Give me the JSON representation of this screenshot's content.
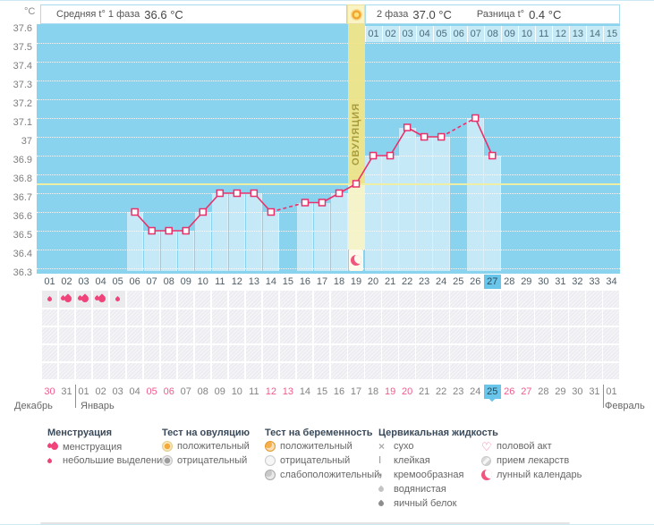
{
  "header": {
    "unit_label": "°C",
    "phase1_label": "Средняя t° 1 фаза",
    "phase1_value": "36.6 °C",
    "phase2_label": "2 фаза",
    "phase2_value": "37.0 °C",
    "diff_label": "Разница t°",
    "diff_value": "0.4 °C"
  },
  "chart_data": {
    "type": "line",
    "title": "Basal body temperature cycle chart",
    "ylabel": "°C",
    "ylim": [
      36.3,
      37.6
    ],
    "yticks": [
      "37.6",
      "37.5",
      "37.4",
      "37.3",
      "37.2",
      "37.1",
      "37",
      "36.9",
      "36.8",
      "36.7",
      "36.6",
      "36.5",
      "36.4",
      "36.3"
    ],
    "grid": "horizontal-dotted",
    "coverline": 36.75,
    "cycle_day_count": 34,
    "cycle_day_labels": [
      "01",
      "02",
      "03",
      "04",
      "05",
      "06",
      "07",
      "08",
      "09",
      "10",
      "11",
      "12",
      "13",
      "14",
      "15",
      "16",
      "17",
      "18",
      "19",
      "20",
      "21",
      "22",
      "23",
      "24",
      "25",
      "26",
      "27",
      "28",
      "29",
      "30",
      "31",
      "32",
      "33",
      "34"
    ],
    "today_cycle_day": 27,
    "ovulation_day": 19,
    "ovulation_label": "ОВУЛЯЦИЯ",
    "post_ovulation_day_labels": [
      "01",
      "02",
      "03",
      "04",
      "05",
      "06",
      "07",
      "08",
      "09",
      "10",
      "11",
      "12",
      "13",
      "14",
      "15"
    ],
    "points": [
      {
        "day": 6,
        "temp": 36.6
      },
      {
        "day": 7,
        "temp": 36.5
      },
      {
        "day": 8,
        "temp": 36.5
      },
      {
        "day": 9,
        "temp": 36.5
      },
      {
        "day": 10,
        "temp": 36.6
      },
      {
        "day": 11,
        "temp": 36.7
      },
      {
        "day": 12,
        "temp": 36.7
      },
      {
        "day": 13,
        "temp": 36.7
      },
      {
        "day": 14,
        "temp": 36.6
      },
      {
        "day": 16,
        "temp": 36.65
      },
      {
        "day": 17,
        "temp": 36.65
      },
      {
        "day": 18,
        "temp": 36.7
      },
      {
        "day": 19,
        "temp": 36.75
      },
      {
        "day": 20,
        "temp": 36.9
      },
      {
        "day": 21,
        "temp": 36.9
      },
      {
        "day": 22,
        "temp": 37.05
      },
      {
        "day": 23,
        "temp": 37.0
      },
      {
        "day": 24,
        "temp": 37.0
      },
      {
        "day": 26,
        "temp": 37.1
      },
      {
        "day": 27,
        "temp": 36.9
      }
    ],
    "missing_days": [
      15,
      25
    ]
  },
  "marks": {
    "menstruation": [
      {
        "day": 1,
        "intensity": "spotting"
      },
      {
        "day": 2,
        "intensity": "full"
      },
      {
        "day": 3,
        "intensity": "full"
      },
      {
        "day": 4,
        "intensity": "full"
      },
      {
        "day": 5,
        "intensity": "spotting"
      }
    ],
    "empty_note_rows": 4
  },
  "calendar": {
    "date_labels": [
      "30",
      "31",
      "01",
      "02",
      "03",
      "04",
      "05",
      "06",
      "07",
      "08",
      "09",
      "10",
      "11",
      "12",
      "13",
      "14",
      "15",
      "16",
      "17",
      "18",
      "19",
      "20",
      "21",
      "22",
      "23",
      "24",
      "25",
      "26",
      "27",
      "28",
      "29",
      "30",
      "31",
      "01"
    ],
    "weekend_indices": [
      0,
      6,
      7,
      13,
      14,
      20,
      21,
      27,
      28
    ],
    "today_index": 26,
    "month_labels": {
      "left": "Декабрь",
      "center": "Январь",
      "right": "Февраль"
    }
  },
  "legend": {
    "columns": [
      {
        "title": "Менструация",
        "items": [
          {
            "icon": "drop-double",
            "label": "менструация"
          },
          {
            "icon": "drop-small",
            "label": "небольшие выделения"
          }
        ]
      },
      {
        "title": "Тест на овуляцию",
        "items": [
          {
            "icon": "radio-orange",
            "label": "положительный"
          },
          {
            "icon": "radio-gray",
            "label": "отрицательный"
          }
        ]
      },
      {
        "title": "Тест на беременность",
        "items": [
          {
            "icon": "preg-positive",
            "label": "положительный"
          },
          {
            "icon": "preg-negative",
            "label": "отрицательный"
          },
          {
            "icon": "preg-weak",
            "label": "слабоположительный"
          }
        ]
      },
      {
        "title": "Цервикальная жидкость",
        "items": [
          {
            "icon": "dry",
            "label": "сухо"
          },
          {
            "icon": "sticky",
            "label": "клейкая"
          },
          {
            "icon": "creamy",
            "label": "кремообразная"
          },
          {
            "icon": "watery",
            "label": "водянистая"
          },
          {
            "icon": "eggwhite",
            "label": "яичный белок"
          }
        ]
      },
      {
        "title": "",
        "items": [
          {
            "icon": "heart",
            "label": "половой акт"
          },
          {
            "icon": "pill",
            "label": "прием лекарств"
          },
          {
            "icon": "moon",
            "label": "лунный календарь"
          }
        ]
      }
    ]
  },
  "colors": {
    "curve": "#e8316b",
    "chart_bg": "#8ad3ee",
    "column_fill": "rgba(255,255,255,0.5)",
    "ovulation_band": "#f2e587",
    "coverline": "#eeefa4",
    "highlight_blue": "#69c6ea",
    "weekend_red": "#f05c8c"
  }
}
